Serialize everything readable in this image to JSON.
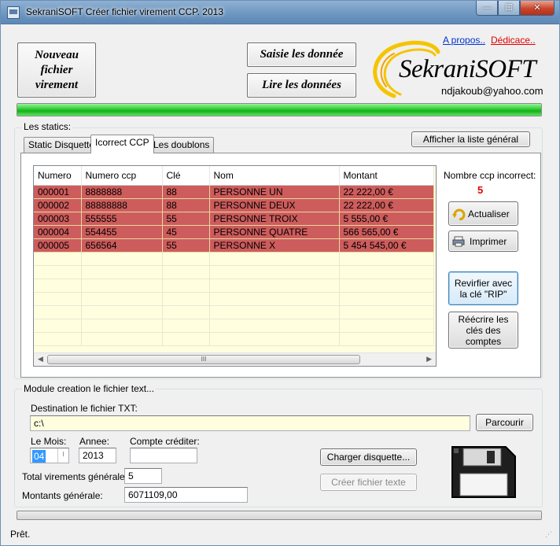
{
  "window": {
    "title": "SekraniSOFT Créer fichier virement CCP.  2013",
    "min": "—",
    "max": "☐",
    "close": "✕"
  },
  "buttons": {
    "nouveau": "Nouveau fichier virement",
    "saisie": "Saisie les donnée",
    "lire": "Lire les données",
    "afficher": "Afficher la liste général",
    "actualiser": "Actualiser",
    "imprimer": "Imprimer",
    "revifier": "Revirfier avec la clé \"RIP\"",
    "reecrire": "Réécrire les clés des comptes",
    "parcourir": "Parcourir",
    "charger": "Charger disquette...",
    "creer": "Créer fichier texte"
  },
  "links": {
    "apropos": "A propos..",
    "dedicace": "Dédicace.."
  },
  "logo": {
    "name": "SekraniSOFT",
    "email": "ndjakoub@yahoo.com"
  },
  "progress": {
    "value": 1.0
  },
  "statics": {
    "title": "Les statics:",
    "tabs": [
      "Static Disquette",
      "Icorrect CCP",
      "Les doublons"
    ],
    "active_tab": 1,
    "count_label": "Nombre ccp incorrect:",
    "count_value": "5"
  },
  "grid": {
    "columns": [
      "Numero",
      "Numero ccp",
      "Clé",
      "Nom",
      "Montant"
    ],
    "rows": [
      [
        "000001",
        "8888888",
        "88",
        "PERSONNE UN",
        "22 222,00 €"
      ],
      [
        "000002",
        "88888888",
        "88",
        "PERSONNE DEUX",
        "22 222,00 €"
      ],
      [
        "000003",
        "555555",
        "55",
        "PERSONNE TROIX",
        "5 555,00 €"
      ],
      [
        "000004",
        "554455",
        "45",
        "PERSONNE QUATRE",
        "566 565,00 €"
      ],
      [
        "000005",
        "656564",
        "55",
        "PERSONNE X",
        "5 454 545,00 €"
      ]
    ],
    "scroll_left": "◀",
    "scroll_right": "▶",
    "scroll_grip": "III"
  },
  "module": {
    "title": "Module creation le fichier text...",
    "destination_label": "Destination le fichier TXT:",
    "destination_value": "c:\\",
    "mois_label": "Le Mois:",
    "mois_value": "04",
    "annee_label": "Annee:",
    "annee_value": "2013",
    "compte_label": "Compte créditer:",
    "compte_value": "",
    "total_label": "Total virements générale:",
    "total_value": "5",
    "montants_label": "Montants générale:",
    "montants_value": "6071109,00"
  },
  "status": {
    "text": "Prêt."
  },
  "colors": {
    "error_row": "#cd5c5c",
    "grid_bg": "#ffffe0",
    "count": "#e00000",
    "progress": "#14b01a"
  }
}
